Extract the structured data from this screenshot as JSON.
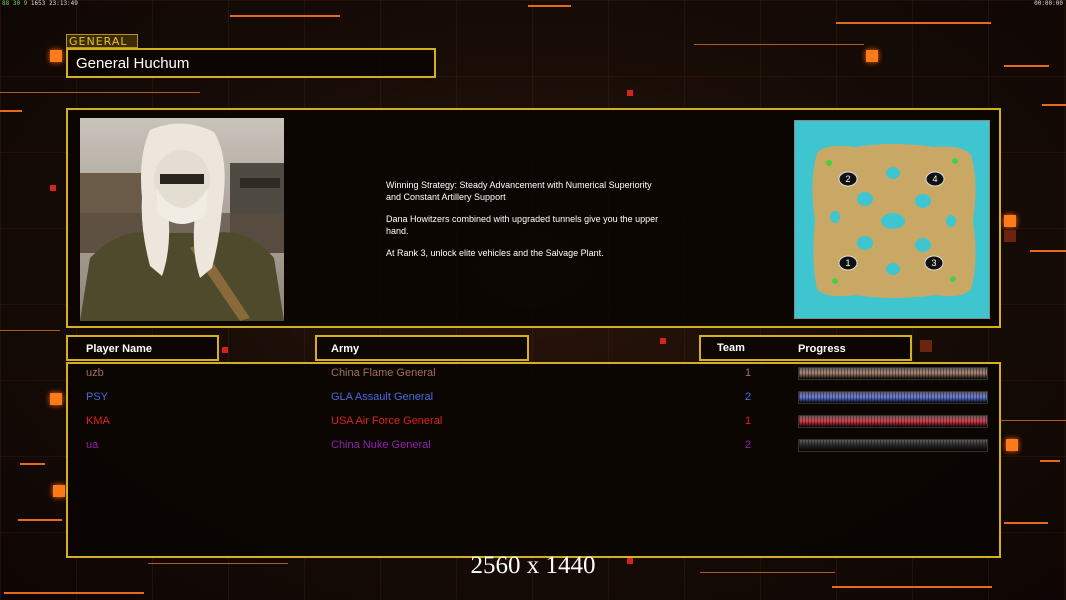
{
  "status_bar": {
    "fps": "88 30 9",
    "extra": "1653",
    "time": "23:13:49"
  },
  "clock": "00:00:00",
  "general_tag": "GENERAL",
  "general_name": "General Huchum",
  "strategy": {
    "p1": "Winning Strategy: Steady Advancement with Numerical Superiority\n and Constant Artillery Support",
    "p2": "Dana Howitzers combined with upgraded tunnels give you the upper\n hand.",
    "p3": "At Rank 3, unlock elite vehicles and the Salvage Plant."
  },
  "minimap": {
    "slots": [
      "1",
      "2",
      "3",
      "4"
    ]
  },
  "table_headers": {
    "player": "Player Name",
    "army": "Army",
    "team": "Team",
    "progress": "Progress"
  },
  "players": [
    {
      "name": "uzb",
      "army": "China Flame General",
      "team": "1",
      "color": "#a0705a",
      "bar": "#b08878"
    },
    {
      "name": "PSY",
      "army": "GLA Assault General",
      "team": "2",
      "color": "#4a68e0",
      "bar": "#6a80e8"
    },
    {
      "name": "KMA",
      "army": "USA Air Force General",
      "team": "1",
      "color": "#e02020",
      "bar": "#e04050"
    },
    {
      "name": "ua",
      "army": "China Nuke General",
      "team": "2",
      "color": "#9020b0",
      "bar": "#2a2a2a"
    }
  ],
  "resolution_text": "2560 x 1440"
}
